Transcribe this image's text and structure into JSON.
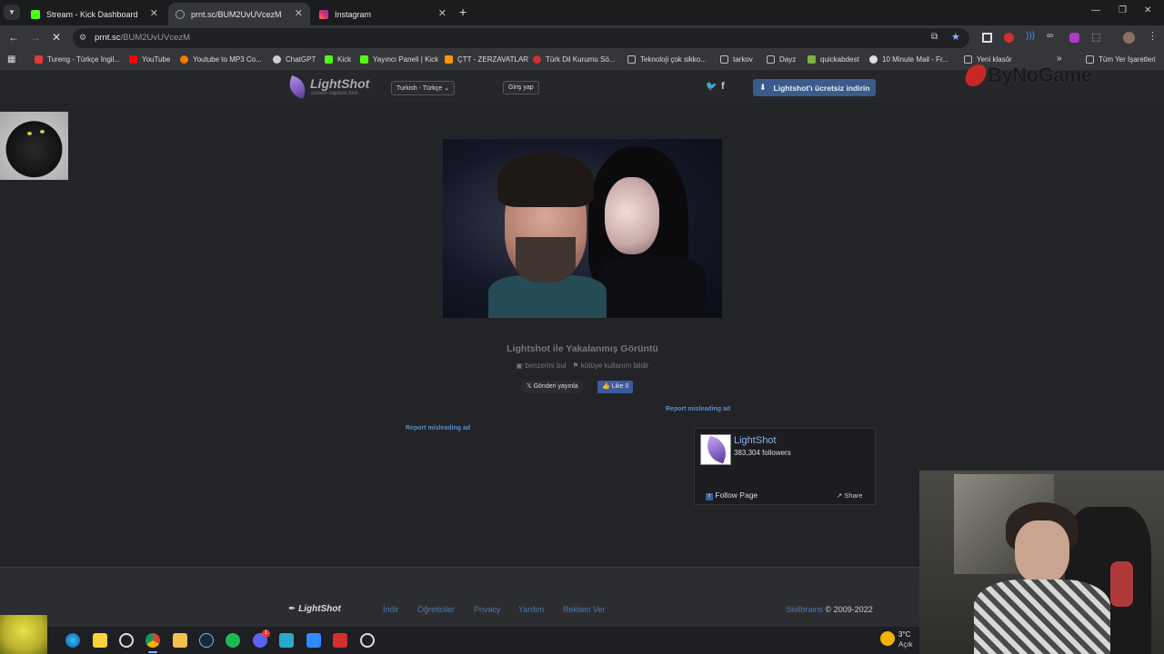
{
  "browser": {
    "tabs": [
      {
        "title": "Stream - Kick Dashboard",
        "favicon_color": "#53fc18"
      },
      {
        "title": "prnt.sc/BUM2UvUVcezM",
        "favicon_color": "#9aa0a6"
      },
      {
        "title": "Instagram",
        "favicon_color": "#e1306c"
      }
    ],
    "new_tab": "+",
    "url_domain": "prnt.sc",
    "url_path": "/BUM2UvUVcezM",
    "bookmarks": [
      {
        "label": "Tureng - Türkçe İngil...",
        "color": "#e53935"
      },
      {
        "label": "YouTube",
        "color": "#ff0000"
      },
      {
        "label": "Youtube to MP3 Co...",
        "color": "#f57c00"
      },
      {
        "label": "ChatGPT",
        "color": "#cfcfcf"
      },
      {
        "label": "Kick",
        "color": "#53fc18"
      },
      {
        "label": "Yayıncı Paneli | Kick",
        "color": "#53fc18"
      },
      {
        "label": "ÇTT - ZERZAVATLAR",
        "color": "#ff9800"
      },
      {
        "label": "Türk Dil Kurumu Sö...",
        "color": "#d32f2f"
      },
      {
        "label": "Teknoloji çok sikko...",
        "color": "#9e9e9e"
      },
      {
        "label": "tarkov",
        "color": "#9e9e9e"
      },
      {
        "label": "Dayz",
        "color": "#9e9e9e"
      },
      {
        "label": "quickabdest",
        "color": "#7cb342"
      },
      {
        "label": "10 Minute Mail - Fr...",
        "color": "#e0e0e0"
      },
      {
        "label": "Yeni klasör",
        "color": "#9e9e9e"
      }
    ],
    "bookmarks_more": "»",
    "all_bookmarks": "Tüm Yer İşaretleri"
  },
  "overlay": {
    "brand": "ByNoGame"
  },
  "lightshot": {
    "logo": "LightShot",
    "logo_sub": "screen capture tool",
    "language": "Turkish - Türkçe",
    "login": "Giriş yap",
    "download_btn": "Lightshot'ı ücretsiz indirin",
    "image_title": "Lightshot ile Yakalanmış Görüntü",
    "find_similar": "benzerini bul",
    "report_abuse": "kötüye kullanım bildir",
    "tweet": "Gönderi yayınla",
    "like": "Like 0",
    "report_ad_1": "Report misleading ad",
    "report_ad_2": "Report misleading ad",
    "fb_name": "LightShot",
    "fb_followers": "383,304 followers",
    "fb_follow": "Follow Page",
    "fb_share": "Share",
    "footer_logo": "LightShot",
    "footer_links": [
      "İndir",
      "Öğreticiler",
      "Privacy",
      "Yardım",
      "Reklam Ver"
    ],
    "footer_company": "Skillbrains",
    "footer_copy": "© 2009-2022"
  },
  "taskbar": {
    "icons": [
      "edge-icon",
      "notes-icon",
      "whatsapp-icon",
      "chrome-icon",
      "files-icon",
      "steam-icon",
      "spotify-icon",
      "discord-icon",
      "app-icon",
      "zoom-icon",
      "acrobat-icon",
      "obs-icon"
    ],
    "weather_temp": "3°C",
    "weather_desc": "Açık",
    "discord_badge": "1"
  }
}
